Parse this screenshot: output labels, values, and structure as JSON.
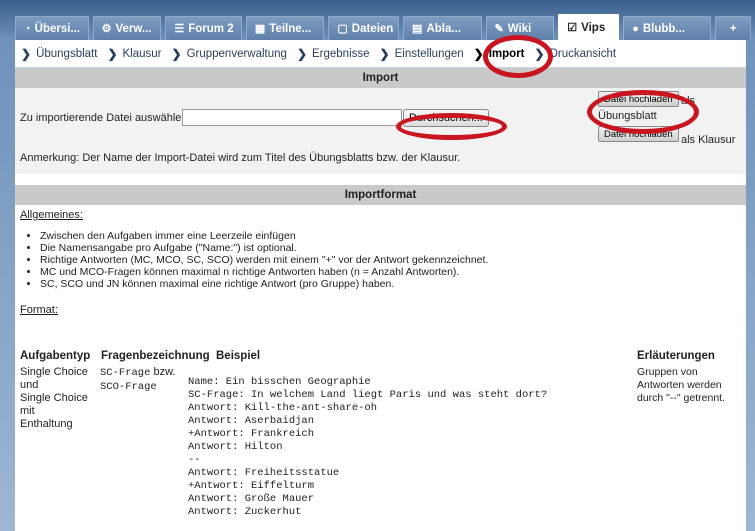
{
  "tabs": [
    {
      "label": "Übersi...",
      "icon": "◔"
    },
    {
      "label": "Verw...",
      "icon": "⚙"
    },
    {
      "label": "Forum 2",
      "icon": "☰"
    },
    {
      "label": "Teilne...",
      "icon": "▦"
    },
    {
      "label": "Dateien",
      "icon": "▢"
    },
    {
      "label": "Abla...",
      "icon": "▤"
    },
    {
      "label": "Wiki",
      "icon": "✎"
    },
    {
      "label": "Vips",
      "icon": "☑"
    },
    {
      "label": "Blubb...",
      "icon": "●"
    },
    {
      "label": "+",
      "icon": ""
    }
  ],
  "subnav": [
    "Übungsblatt",
    "Klausur",
    "Gruppenverwaltung",
    "Ergebnisse",
    "Einstellungen",
    "Import",
    "Druckansicht"
  ],
  "import": {
    "header": "Import",
    "file_label": "Zu importierende Datei auswählen:",
    "browse": "Durchsuchen...",
    "upload": "Datei hochladen",
    "als": "als",
    "uebungsblatt": "Übungsblatt",
    "als_klausur": "als Klausur",
    "note": "Anmerkung: Der Name der Import-Datei wird zum Titel des Übungsblatts bzw. der Klausur."
  },
  "format": {
    "header": "Importformat",
    "general_title": "Allgemeines:",
    "bullets": [
      "Zwischen den Aufgaben immer eine Leerzeile einfügen",
      "Die Namensangabe pro Aufgabe (\"Name:\") ist optional.",
      "Richtige Antworten (MC, MCO, SC, SCO) werden mit einem \"+\" vor der Antwort gekennzeichnet.",
      "MC und MCO-Fragen können maximal n richtige Antworten haben (n = Anzahl Antworten).",
      "SC, SCO und JN können maximal eine richtige Antwort (pro Gruppe) haben."
    ],
    "format_title": "Format:",
    "col_type": "Aufgabentyp",
    "col_question": "Fragenbezeichnung",
    "col_example": "Beispiel",
    "col_notes": "Erläuterungen",
    "type_text": "Single Choice\nund\nSingle Choice\nmit\nEnthaltung",
    "question_a": "SC-Frage",
    "question_bzw": " bzw.",
    "question_b": "SCO-Frage",
    "example": "Name: Ein bisschen Geographie\nSC-Frage: In welchem Land liegt Paris und was steht dort?\nAntwort: Kill-the-ant-share-oh\nAntwort: Aserbaidjan\n+Antwort: Frankreich\nAntwort: Hilton\n--\nAntwort: Freiheitsstatue\n+Antwort: Eiffelturm\nAntwort: Große Mauer\nAntwort: Zuckerhut",
    "notes": "Gruppen von\nAntworten werden\ndurch \"--\" getrennt."
  }
}
